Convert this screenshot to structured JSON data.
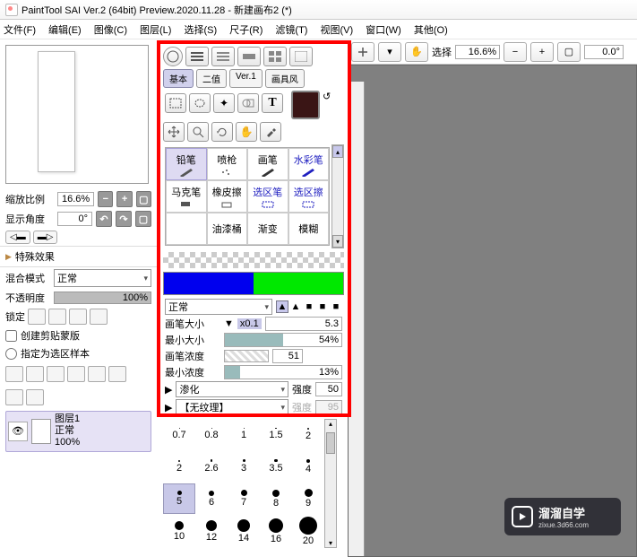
{
  "title": "PaintTool SAI Ver.2 (64bit) Preview.2020.11.28 - 新建画布2 (*)",
  "menu": [
    "文件(F)",
    "编辑(E)",
    "图像(C)",
    "图层(L)",
    "选择(S)",
    "尺子(R)",
    "滤镜(T)",
    "视图(V)",
    "窗口(W)",
    "其他(O)"
  ],
  "nav": {
    "zoom_label": "缩放比例",
    "zoom_value": "16.6%",
    "rot_label": "显示角度",
    "rot_value": "0°"
  },
  "fx_header": "特殊效果",
  "blend": {
    "label": "混合模式",
    "value": "正常"
  },
  "opacity": {
    "label": "不透明度",
    "value": "100%"
  },
  "lock_label": "锁定",
  "clip_label": "创建剪贴蒙版",
  "sample_label": "指定为选区样本",
  "layer": {
    "name": "图层1",
    "mode": "正常",
    "opacity": "100%"
  },
  "pattern_tabs": {
    "base": "基本",
    "binary": "二值",
    "ver1": "Ver.1",
    "style": "画具风"
  },
  "brushes": {
    "r1": [
      "铅笔",
      "喷枪",
      "画笔",
      "水彩笔"
    ],
    "r2": [
      "马克笔",
      "橡皮擦",
      "选区笔",
      "选区擦"
    ],
    "r3": [
      "",
      "油漆桶",
      "渐变",
      "模糊"
    ]
  },
  "brush_mode": "正常",
  "params": {
    "size_label": "画笔大小",
    "size_mult": "x0.1",
    "size_val": "5.3",
    "min_label": "最小大小",
    "min_val": "54%",
    "dens_label": "画笔浓度",
    "dens_val": "51",
    "mindens_label": "最小浓度",
    "mindens_val": "13%",
    "blend_label": "渗化",
    "blend_str_label": "强度",
    "blend_str_val": "50",
    "tex_label": "【无纹理】",
    "tex_str_label": "强度",
    "tex_str_val": "95"
  },
  "toolbar": {
    "select_label": "选择",
    "zoom": "16.6%",
    "angle": "0.0°"
  },
  "dots": [
    [
      "0.7",
      "0.8",
      "1",
      "1.5",
      "2"
    ],
    [
      "2",
      "2.6",
      "3",
      "3.5",
      "4"
    ],
    [
      "5",
      "6",
      "7",
      "8",
      "9"
    ],
    [
      "10",
      "12",
      "14",
      "16",
      "20"
    ]
  ],
  "watermark": {
    "text": "溜溜自学",
    "url": "zixue.3d66.com"
  }
}
